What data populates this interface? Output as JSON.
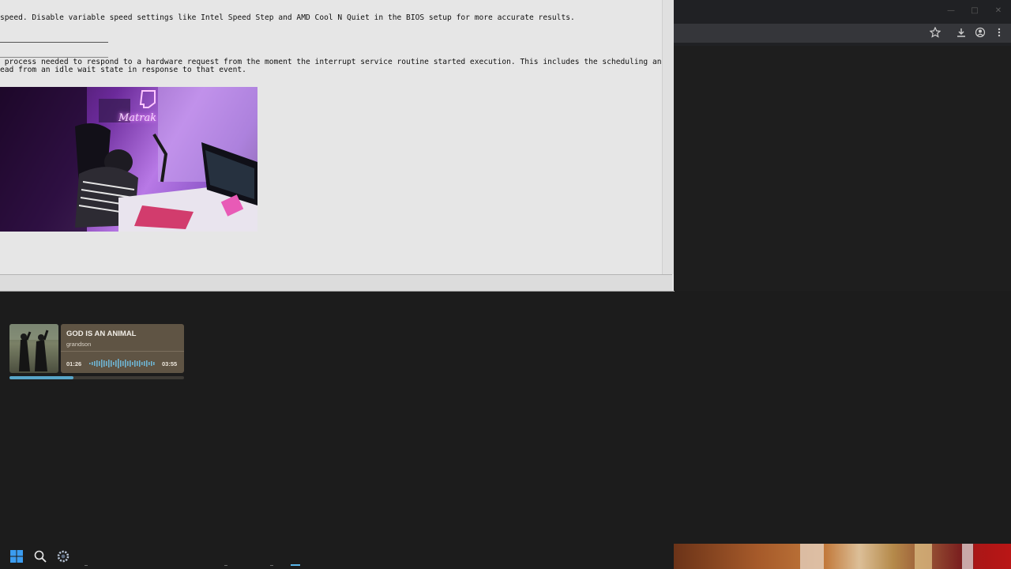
{
  "document": {
    "line1": "speed. Disable variable speed settings like Intel Speed Step and AMD Cool N Quiet in the BIOS setup for more accurate results.",
    "line2": " process needed to respond to a hardware request from the moment the interrupt service routine started execution. This includes the scheduling and execution",
    "line3": "ead from an idle wait state in response to that event.",
    "image_neon_text": "Matrak"
  },
  "browser": {
    "window_controls": {
      "minimize": "—",
      "maximize": "□",
      "close": "✕"
    },
    "toolbar_icons": [
      "star-icon",
      "download-icon",
      "profile-icon",
      "more-icon"
    ]
  },
  "music_player": {
    "title": "GOD IS AN ANIMAL",
    "artist": "grandson",
    "elapsed": "01:26",
    "duration": "03:55",
    "progress": 0.365,
    "accent_color": "#58a6c9"
  },
  "taskbar": {
    "icons": [
      "windows-start-icon",
      "search-icon",
      "settings-icon"
    ]
  }
}
